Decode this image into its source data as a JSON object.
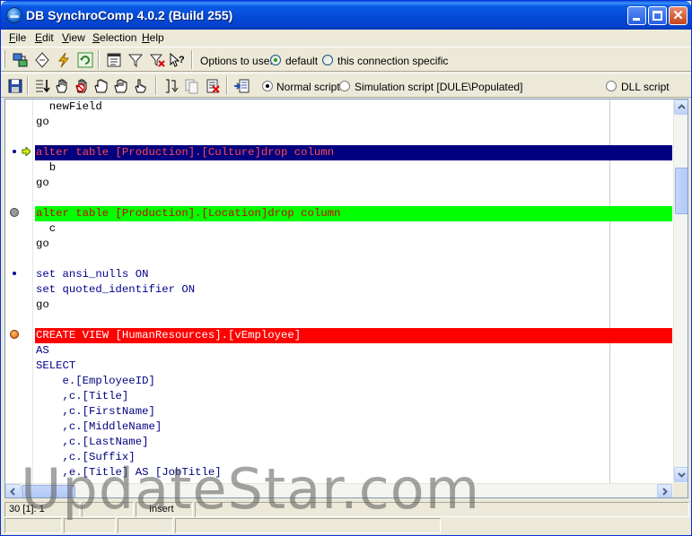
{
  "window": {
    "title": "DB SynchroComp 4.0.2  (Build 255)"
  },
  "menu": [
    {
      "label": "File",
      "accel": "F",
      "rest": "ile"
    },
    {
      "label": "Edit",
      "accel": "E",
      "rest": "dit"
    },
    {
      "label": "View",
      "accel": "V",
      "rest": "iew"
    },
    {
      "label": "Selection",
      "accel": "S",
      "rest": "election"
    },
    {
      "label": "Help",
      "accel": "H",
      "rest": "elp"
    }
  ],
  "toolbar1": {
    "options_label": "Options to use:",
    "option_default": "default",
    "option_connection": "this connection specific",
    "selected": "default"
  },
  "toolbar2": {
    "normal_script": "Normal script",
    "simulation_script": "Simulation script [DULE\\Populated]",
    "dll_script": "DLL script",
    "selected": "normal"
  },
  "code_lines": [
    {
      "text": "  newField"
    },
    {
      "text": "go"
    },
    {
      "text": ""
    },
    {
      "text": "alter table [Production].[Culture]drop column",
      "highlight": "blue"
    },
    {
      "text": "  b"
    },
    {
      "text": "go"
    },
    {
      "text": ""
    },
    {
      "text": "alter table [Production].[Location]drop column",
      "highlight": "green"
    },
    {
      "text": "  c"
    },
    {
      "text": "go"
    },
    {
      "text": ""
    },
    {
      "text": "set ansi_nulls ON"
    },
    {
      "text": "set quoted_identifier ON"
    },
    {
      "text": "go"
    },
    {
      "text": ""
    },
    {
      "text": "CREATE VIEW [HumanResources].[vEmployee]",
      "highlight": "red"
    },
    {
      "text": "AS"
    },
    {
      "text": "SELECT"
    },
    {
      "text": "    e.[EmployeeID]"
    },
    {
      "text": "    ,c.[Title]"
    },
    {
      "text": "    ,c.[FirstName]"
    },
    {
      "text": "    ,c.[MiddleName]"
    },
    {
      "text": "    ,c.[LastName]"
    },
    {
      "text": "    ,c.[Suffix]"
    },
    {
      "text": "    ,e.[Title] AS [JobTitle]"
    }
  ],
  "status": {
    "position": "30 [1]:  1",
    "mode": "Insert"
  },
  "watermark": "UpdateStar.com",
  "colors": {
    "highlight_blue": "#000080",
    "highlight_green": "#00ff00",
    "highlight_red": "#ff0000",
    "keyword": "#00008b"
  }
}
